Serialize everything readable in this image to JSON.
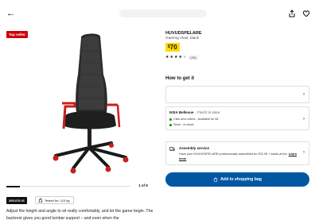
{
  "badge": "Top seller",
  "product": {
    "name": "HUVUDSPELARE",
    "type": "Gaming chair, black",
    "price_currency": "$",
    "price_value": "70",
    "rating_count": "(26)",
    "rating_stars": 4.5
  },
  "gallery": {
    "counter": "1 of 9",
    "progress": 0.11
  },
  "article_number": "205.076.01",
  "weight_label": "Tested for: 110 kg",
  "description": "Adjust the height and angle to sit really comfortably, and let the game begin. The backrest gives you good lumbar support – and even when the",
  "how_to_get": {
    "title": "How to get it"
  },
  "store": {
    "name": "IKEA Bellevue",
    "muted": "· Find it in store",
    "line1": "Click and collect - Available for $2",
    "line2": "Store - In stock"
  },
  "assembly": {
    "title": "Assembly service",
    "text": "Have your HUVUDSPELARE professionally assembled for €22.95 + starts-at fee.",
    "link": "Learn more"
  },
  "add_button": "Add to shopping bag",
  "colors": {
    "accent": "#0058a3",
    "price_bg": "#ffdb00",
    "badge": "#cc0008",
    "stock_green": "#0a8a00"
  }
}
